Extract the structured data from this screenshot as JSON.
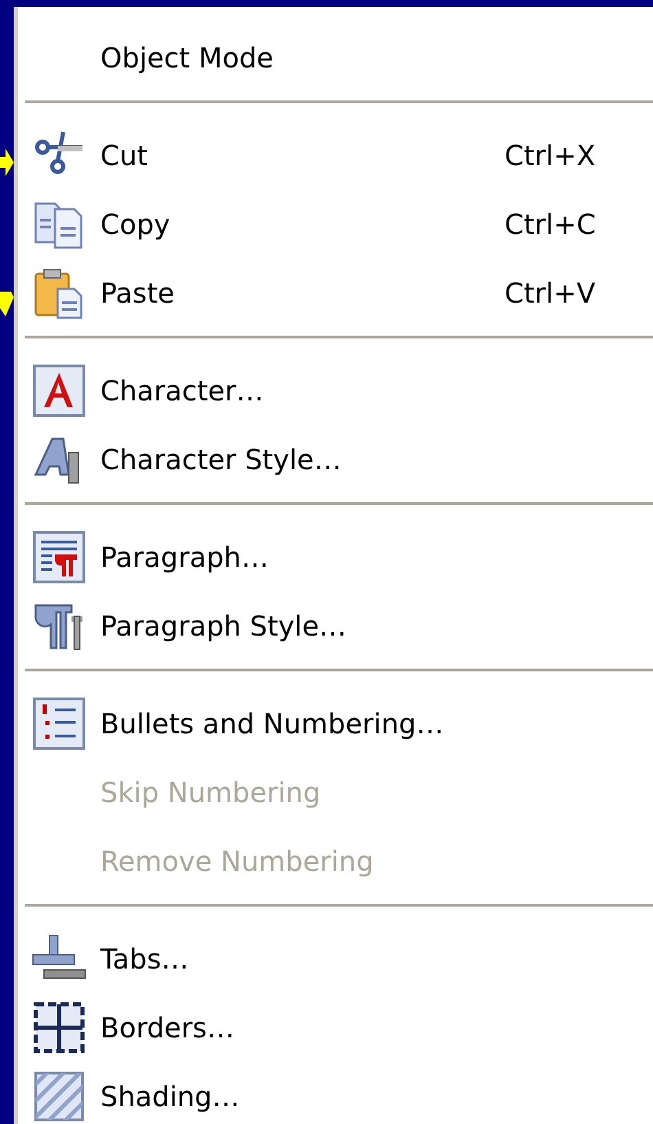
{
  "menu": {
    "sections": [
      {
        "items": [
          {
            "label": "Object Mode",
            "disabled": false
          }
        ]
      },
      {
        "items": [
          {
            "label": "Cut",
            "shortcut": "Ctrl+X",
            "disabled": false
          },
          {
            "label": "Copy",
            "shortcut": "Ctrl+C",
            "disabled": false
          },
          {
            "label": "Paste",
            "shortcut": "Ctrl+V",
            "disabled": false
          }
        ]
      },
      {
        "items": [
          {
            "label": "Character…",
            "disabled": false
          },
          {
            "label": "Character Style…",
            "disabled": false
          }
        ]
      },
      {
        "items": [
          {
            "label": "Paragraph…",
            "disabled": false
          },
          {
            "label": "Paragraph Style…",
            "disabled": false
          }
        ]
      },
      {
        "items": [
          {
            "label": "Bullets and Numbering…",
            "disabled": false
          },
          {
            "label": "Skip Numbering",
            "disabled": true
          },
          {
            "label": "Remove Numbering",
            "disabled": true
          }
        ]
      },
      {
        "items": [
          {
            "label": "Tabs…",
            "disabled": false
          },
          {
            "label": "Borders…",
            "disabled": false
          },
          {
            "label": "Shading…",
            "disabled": false
          }
        ]
      }
    ]
  }
}
